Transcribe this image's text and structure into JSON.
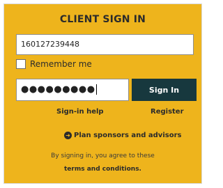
{
  "signin": {
    "title": "CLIENT SIGN IN",
    "username_value": "160127239448",
    "remember_label": "Remember me",
    "remember_checked": false,
    "password_mask": "●●●●●●●●●",
    "button_label": "Sign In",
    "help_link": "Sign-in help",
    "register_link": "Register",
    "plan_link": "Plan sponsors and advisors",
    "plan_icon": "arrow-right-circle-icon",
    "disclaimer": "By signing in, you agree to these",
    "terms_link": "terms and conditions.",
    "colors": {
      "panel": "#eeb41c",
      "button": "#17383e",
      "text": "#2b2b2b"
    }
  }
}
